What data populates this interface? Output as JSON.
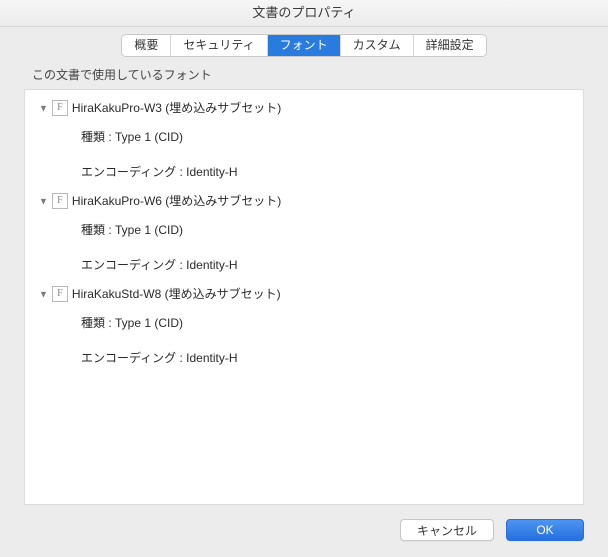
{
  "title": "文書のプロパティ",
  "tabs": [
    {
      "label": "概要"
    },
    {
      "label": "セキュリティ"
    },
    {
      "label": "フォント"
    },
    {
      "label": "カスタム"
    },
    {
      "label": "詳細設定"
    }
  ],
  "active_tab_index": 2,
  "caption": "この文書で使用しているフォント",
  "labels": {
    "type_prefix": "種類 : ",
    "encoding_prefix": "エンコーディング : "
  },
  "fonts": [
    {
      "name": "HiraKakuPro-W3 (埋め込みサブセット)",
      "type": "Type 1 (CID)",
      "encoding": "Identity-H"
    },
    {
      "name": "HiraKakuPro-W6 (埋め込みサブセット)",
      "type": "Type 1 (CID)",
      "encoding": "Identity-H"
    },
    {
      "name": "HiraKakuStd-W8 (埋め込みサブセット)",
      "type": "Type 1 (CID)",
      "encoding": "Identity-H"
    }
  ],
  "buttons": {
    "cancel": "キャンセル",
    "ok": "OK"
  }
}
